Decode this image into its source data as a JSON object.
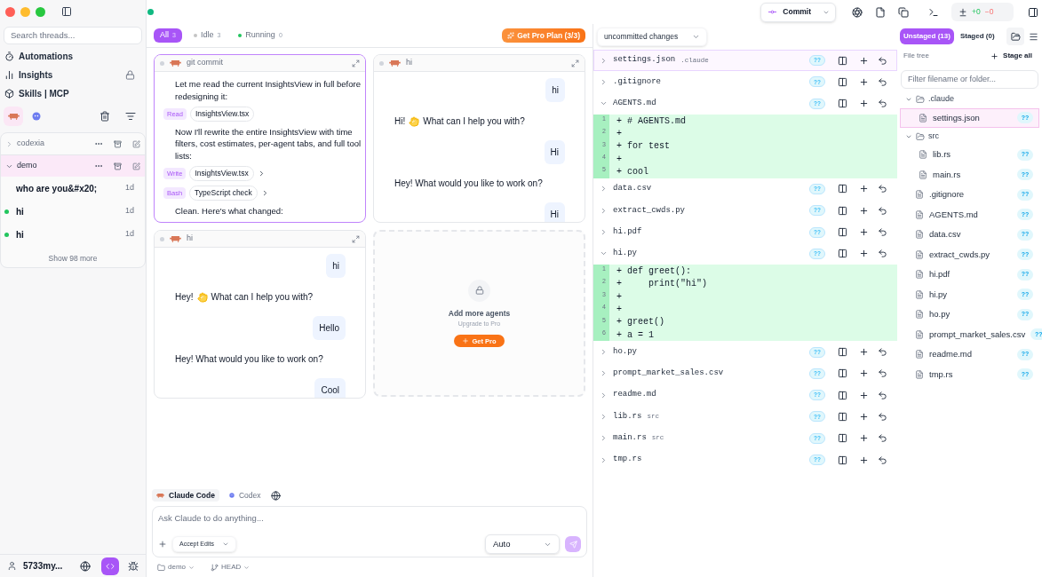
{
  "sidebar": {
    "search_placeholder": "Search threads...",
    "nav": [
      {
        "label": "Automations",
        "locked": false
      },
      {
        "label": "Insights",
        "locked": true
      },
      {
        "label": "Skills | MCP",
        "locked": false
      }
    ],
    "agents": [
      {
        "selected": true
      },
      {
        "selected": false
      }
    ],
    "projects": [
      {
        "name": "codexia",
        "expanded": false,
        "selected": false
      },
      {
        "name": "demo",
        "expanded": true,
        "selected": true,
        "threads": [
          {
            "title": "who are you&#x20;",
            "time": "1d",
            "running": false
          },
          {
            "title": "hi",
            "time": "1d",
            "running": true
          },
          {
            "title": "hi",
            "time": "1d",
            "running": true
          }
        ],
        "more": "Show 98 more"
      }
    ],
    "user": "5733my..."
  },
  "topbar": {
    "connected": true,
    "commit": "Commit",
    "added": "+0",
    "removed": "−0"
  },
  "filters": [
    {
      "label": "All",
      "count": "3",
      "selected": true
    },
    {
      "label": "Idle",
      "count": "3",
      "selected": false,
      "color": "#c4c4c4"
    },
    {
      "label": "Running",
      "count": "0",
      "selected": false,
      "color": "#22c55e"
    }
  ],
  "pro_button": "Get Pro Plan (3/3)",
  "cards": [
    {
      "title": "git commit",
      "focused": true,
      "messages": [
        {
          "kind": "text",
          "text": "Let me read the current InsightsView in full before redesigning it:"
        },
        {
          "kind": "tool",
          "tool": "Read",
          "file": "InsightsView.tsx",
          "expandable": false
        },
        {
          "kind": "text",
          "text": "Now I'll rewrite the entire InsightsView with time filters, cost estimates, per-agent tabs, and full tool lists:"
        },
        {
          "kind": "tool",
          "tool": "Write",
          "file": "InsightsView.tsx",
          "expandable": true
        },
        {
          "kind": "tool",
          "tool": "Bash",
          "file": "TypeScript check",
          "expandable": true
        },
        {
          "kind": "text",
          "text": "Clean. Here's what changed:"
        }
      ]
    },
    {
      "title": "hi",
      "focused": false,
      "messages": [
        {
          "kind": "user",
          "text": "hi"
        },
        {
          "kind": "assistant",
          "text": "Hi!",
          "after_wave": "What can I help you with?"
        },
        {
          "kind": "user",
          "text": "Hi"
        },
        {
          "kind": "assistant",
          "text": "Hey! What would you like to work on?"
        },
        {
          "kind": "user",
          "text": "Hi"
        }
      ]
    },
    {
      "title": "hi",
      "focused": false,
      "messages": [
        {
          "kind": "user",
          "text": "hi"
        },
        {
          "kind": "assistant",
          "text": "Hey!",
          "after_wave": "What can I help you with?"
        },
        {
          "kind": "user",
          "text": "Hello"
        },
        {
          "kind": "assistant",
          "text": "Hey! What would you like to work on?"
        },
        {
          "kind": "user",
          "text": "Cool"
        }
      ]
    }
  ],
  "upsell": {
    "title": "Add more agents",
    "subtitle": "Upgrade to Pro",
    "button": "Get Pro"
  },
  "composer": {
    "tabs": [
      {
        "label": "Claude Code",
        "selected": true
      },
      {
        "label": "Codex",
        "selected": false
      }
    ],
    "placeholder": "Ask Claude to do anything...",
    "mode": "Accept Edits",
    "model": "Auto",
    "folder": "demo",
    "branch": "HEAD"
  },
  "changes": {
    "scope": "uncommitted changes",
    "files": [
      {
        "name": "settings.json",
        "dir": ".claude",
        "status": "??",
        "selected": true,
        "expanded": false
      },
      {
        "name": ".gitignore",
        "status": "??",
        "selected": false,
        "expanded": false
      },
      {
        "name": "AGENTS.md",
        "status": "??",
        "selected": false,
        "expanded": true,
        "lines": [
          {
            "num": "1",
            "text": "+ # AGENTS.md"
          },
          {
            "num": "2",
            "text": "+"
          },
          {
            "num": "3",
            "text": "+ for test"
          },
          {
            "num": "4",
            "text": "+"
          },
          {
            "num": "5",
            "text": "+ cool"
          }
        ]
      },
      {
        "name": "data.csv",
        "status": "??",
        "selected": false,
        "expanded": false
      },
      {
        "name": "extract_cwds.py",
        "status": "??",
        "selected": false,
        "expanded": false
      },
      {
        "name": "hi.pdf",
        "status": "??",
        "selected": false,
        "expanded": false
      },
      {
        "name": "hi.py",
        "status": "??",
        "selected": false,
        "expanded": true,
        "lines": [
          {
            "num": "1",
            "text": "+ def greet():"
          },
          {
            "num": "2",
            "text": "+     print(\"hi\")"
          },
          {
            "num": "3",
            "text": "+"
          },
          {
            "num": "4",
            "text": "+"
          },
          {
            "num": "5",
            "text": "+ greet()"
          },
          {
            "num": "6",
            "text": "+ a = 1"
          }
        ]
      },
      {
        "name": "ho.py",
        "status": "??",
        "selected": false,
        "expanded": false
      },
      {
        "name": "prompt_market_sales.csv",
        "status": "??",
        "selected": false,
        "expanded": false
      },
      {
        "name": "readme.md",
        "status": "??",
        "selected": false,
        "expanded": false
      },
      {
        "name": "lib.rs",
        "dir": "src",
        "status": "??",
        "selected": false,
        "expanded": false
      },
      {
        "name": "main.rs",
        "dir": "src",
        "status": "??",
        "selected": false,
        "expanded": false
      },
      {
        "name": "tmp.rs",
        "status": "??",
        "selected": false,
        "expanded": false
      }
    ]
  },
  "staging": {
    "tabs": [
      {
        "label": "Unstaged (13)",
        "selected": true
      },
      {
        "label": "Staged (0)",
        "selected": false
      }
    ],
    "tree_label": "File tree",
    "stage_all": "Stage all",
    "filter_placeholder": "Filter filename or folder...",
    "tree": [
      {
        "kind": "folder",
        "name": ".claude",
        "expanded": true,
        "children": [
          {
            "kind": "file",
            "name": "settings.json",
            "status": "??",
            "selected": true
          }
        ]
      },
      {
        "kind": "folder",
        "name": "src",
        "expanded": true,
        "children": [
          {
            "kind": "file",
            "name": "lib.rs",
            "status": "??",
            "selected": false
          },
          {
            "kind": "file",
            "name": "main.rs",
            "status": "??",
            "selected": false
          }
        ]
      },
      {
        "kind": "file",
        "name": ".gitignore",
        "status": "??",
        "selected": false
      },
      {
        "kind": "file",
        "name": "AGENTS.md",
        "status": "??",
        "selected": false
      },
      {
        "kind": "file",
        "name": "data.csv",
        "status": "??",
        "selected": false
      },
      {
        "kind": "file",
        "name": "extract_cwds.py",
        "status": "??",
        "selected": false
      },
      {
        "kind": "file",
        "name": "hi.pdf",
        "status": "??",
        "selected": false
      },
      {
        "kind": "file",
        "name": "hi.py",
        "status": "??",
        "selected": false
      },
      {
        "kind": "file",
        "name": "ho.py",
        "status": "??",
        "selected": false
      },
      {
        "kind": "file",
        "name": "prompt_market_sales.csv",
        "status": "??",
        "selected": false
      },
      {
        "kind": "file",
        "name": "readme.md",
        "status": "??",
        "selected": false
      },
      {
        "kind": "file",
        "name": "tmp.rs",
        "status": "??",
        "selected": false
      }
    ]
  }
}
